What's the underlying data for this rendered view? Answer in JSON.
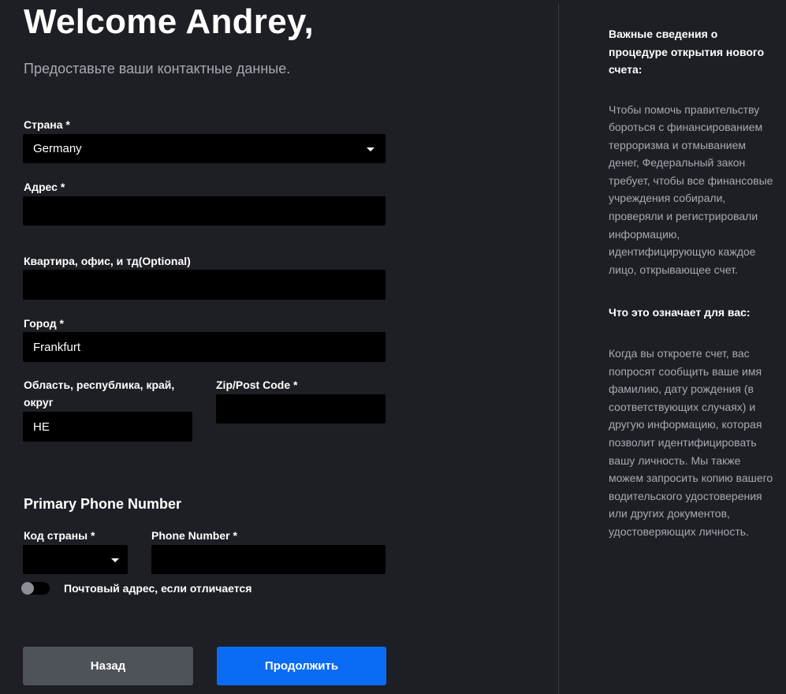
{
  "header": {
    "title": "Welcome Andrey,",
    "subtitle": "Предоставьте ваши контактные данные."
  },
  "form": {
    "country": {
      "label": "Страна *",
      "value": "Germany"
    },
    "address": {
      "label": "Адрес *",
      "value": ""
    },
    "apartment": {
      "label": "Квартира, офис, и тд(Optional)",
      "value": ""
    },
    "city": {
      "label": "Город *",
      "value": "Frankfurt"
    },
    "region": {
      "label": "Область, республика, край, округ",
      "value": "HE"
    },
    "zip": {
      "label": "Zip/Post Code *",
      "value": ""
    }
  },
  "phone": {
    "heading": "Primary Phone Number",
    "country_code": {
      "label": "Код страны *",
      "value": ""
    },
    "number": {
      "label": "Phone Number *",
      "value": ""
    }
  },
  "mailing_toggle": {
    "label": "Почтовый адрес, если отличается",
    "on": false
  },
  "buttons": {
    "back": "Назад",
    "continue": "Продолжить"
  },
  "side": {
    "title1": "Важные сведения о процедуре открытия нового счета:",
    "text1": "Чтобы помочь правительству бороться с финансированием терроризма и отмыванием денег, Федеральный закон требует, чтобы все финансовые учреждения собирали, проверяли и регистрировали информацию, идентифицирующую каждое лицо, открывающее счет.",
    "title2": "Что это означает для вас:",
    "text2": "Когда вы откроете счет, вас попросят сообщить ваше имя фамилию, дату рождения (в соответствующих случаях) и другую информацию, которая позволит идентифицировать вашу личность. Мы также можем запросить копию вашего водительского удостоверения или других документов, удостоверяющих личность."
  },
  "colors": {
    "background": "#1e1f25",
    "field": "#000000",
    "primary_button": "#0a6cf5",
    "secondary_button": "#4e5259",
    "muted_text": "#a7aab1"
  },
  "icons": {
    "dropdown": "caret-down-icon"
  }
}
